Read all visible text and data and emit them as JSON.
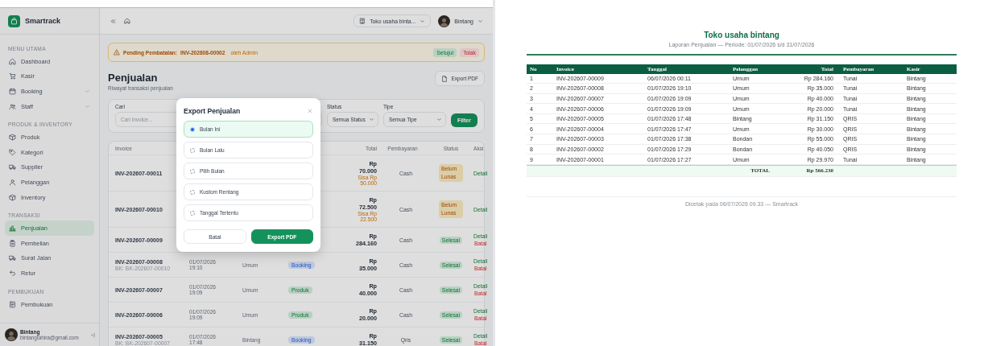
{
  "sidebar": {
    "brand": "Smartrack",
    "sections": [
      {
        "title": "MENU UTAMA",
        "items": [
          {
            "label": "Dashboard",
            "selected": false,
            "expandable": false
          },
          {
            "label": "Kasir",
            "selected": false,
            "expandable": false
          },
          {
            "label": "Booking",
            "selected": false,
            "expandable": true
          },
          {
            "label": "Staff",
            "selected": false,
            "expandable": true
          }
        ]
      },
      {
        "title": "PRODUK & INVENTORY",
        "items": [
          {
            "label": "Produk",
            "selected": false,
            "expandable": false
          },
          {
            "label": "Kategori",
            "selected": false,
            "expandable": false
          },
          {
            "label": "Supplier",
            "selected": false,
            "expandable": false
          },
          {
            "label": "Pelanggan",
            "selected": false,
            "expandable": false
          },
          {
            "label": "Inventory",
            "selected": false,
            "expandable": false
          }
        ]
      },
      {
        "title": "TRANSAKSI",
        "items": [
          {
            "label": "Penjualan",
            "selected": true,
            "expandable": false
          },
          {
            "label": "Pembelian",
            "selected": false,
            "expandable": false
          },
          {
            "label": "Surat Jalan",
            "selected": false,
            "expandable": false
          },
          {
            "label": "Retur",
            "selected": false,
            "expandable": false
          }
        ]
      },
      {
        "title": "PEMBUKUAN",
        "items": [
          {
            "label": "Pembukuan",
            "selected": false,
            "expandable": false
          }
        ]
      }
    ],
    "user": {
      "name": "Bintang",
      "email": "bintangtahira@gmail.com"
    }
  },
  "topbar": {
    "store": "Toko usaha binta...",
    "user": "Bintang"
  },
  "alert": {
    "label": "Pending Pembatalan:",
    "invoice": "INV-202608-00002",
    "by": "oleh Admin",
    "actions": [
      {
        "label": "Setujui",
        "kind": "approve"
      },
      {
        "label": "Tolak",
        "kind": "reject"
      }
    ]
  },
  "page": {
    "title": "Penjualan",
    "subtitle": "Riwayat transaksi penjualan",
    "export_button": "Export PDF"
  },
  "filters": {
    "fields": [
      {
        "label": "Cari",
        "kind": "text",
        "placeholder": "Cari invoice..."
      },
      {
        "label": "Status",
        "kind": "select",
        "value": "Semua Status"
      },
      {
        "label": "Tipe",
        "kind": "select",
        "value": "Semua Tipe"
      }
    ],
    "button": "Filter"
  },
  "table": {
    "columns": [
      "Invoice",
      "Total",
      "Pembayaran",
      "Status",
      "Aksi"
    ],
    "rows": [
      {
        "invoice": "INV-202607-00011",
        "total": "Rp 70.000",
        "remaining": "Sisa Rp 50.000",
        "payment": "Cash",
        "status": {
          "label": "Belum Lunas",
          "kind": "unpaid"
        },
        "actions": [
          {
            "label": "Detail",
            "kind": "detail"
          }
        ]
      },
      {
        "invoice": "INV-202607-00010",
        "total": "Rp 72.500",
        "remaining": "Sisa Rp 22.500",
        "payment": "Cash",
        "status": {
          "label": "Belum Lunas",
          "kind": "unpaid"
        },
        "actions": [
          {
            "label": "Detail",
            "kind": "detail"
          }
        ]
      },
      {
        "invoice": "INV-202607-00009",
        "total": "Rp 284.160",
        "payment": "Cash",
        "status": {
          "label": "Selesai",
          "kind": "done"
        },
        "actions": [
          {
            "label": "Detail",
            "kind": "detail"
          },
          {
            "label": "Batal",
            "kind": "cancel"
          }
        ]
      },
      {
        "invoice": "INV-202607-00008",
        "ref": "BK: BK-202607-00010",
        "date": "01/07/2026 19:10",
        "customer": "Umum",
        "type": {
          "label": "Booking",
          "kind": "booking"
        },
        "total": "Rp 35.000",
        "payment": "Cash",
        "status": {
          "label": "Selesai",
          "kind": "done"
        },
        "actions": [
          {
            "label": "Detail",
            "kind": "detail"
          },
          {
            "label": "Batal",
            "kind": "cancel"
          }
        ]
      },
      {
        "invoice": "INV-202607-00007",
        "date": "01/07/2026 19:09",
        "customer": "Umum",
        "type": {
          "label": "Produk",
          "kind": "product"
        },
        "total": "Rp 40.000",
        "payment": "Cash",
        "status": {
          "label": "Selesai",
          "kind": "done"
        },
        "actions": [
          {
            "label": "Detail",
            "kind": "detail"
          },
          {
            "label": "Batal",
            "kind": "cancel"
          }
        ]
      },
      {
        "invoice": "INV-202607-00006",
        "date": "01/07/2026 19:09",
        "customer": "Umum",
        "type": {
          "label": "Produk",
          "kind": "product"
        },
        "total": "Rp 20.000",
        "payment": "Cash",
        "status": {
          "label": "Selesai",
          "kind": "done"
        },
        "actions": [
          {
            "label": "Detail",
            "kind": "detail"
          },
          {
            "label": "Batal",
            "kind": "cancel"
          }
        ]
      },
      {
        "invoice": "INV-202607-00005",
        "ref": "BK: BK-202607-00007",
        "date": "01/07/2026 17:48",
        "customer": "Bintang",
        "type": {
          "label": "Booking",
          "kind": "booking"
        },
        "total": "Rp 31.150",
        "payment": "Qris",
        "status": {
          "label": "Selesai",
          "kind": "done"
        },
        "actions": [
          {
            "label": "Detail",
            "kind": "detail"
          },
          {
            "label": "Batal",
            "kind": "cancel"
          }
        ]
      }
    ]
  },
  "modal": {
    "title": "Export Penjualan",
    "options": [
      {
        "label": "Bulan Ini",
        "selected": true
      },
      {
        "label": "Bulan Lalu",
        "selected": false
      },
      {
        "label": "Pilih Bulan",
        "selected": false
      },
      {
        "label": "Kustom Rentang",
        "selected": false
      },
      {
        "label": "Tanggal Tertentu",
        "selected": false
      }
    ],
    "buttons": [
      {
        "label": "Batal",
        "kind": "secondary"
      },
      {
        "label": "Export PDF",
        "kind": "primary"
      }
    ]
  },
  "report": {
    "title": "Toko usaha bintang",
    "subtitle": "Laporan Penjualan — Periode: 01/07/2026 s/d 31/07/2026",
    "columns": [
      "No",
      "Invoice",
      "Tanggal",
      "Pelanggan",
      "Total",
      "Pembayaran",
      "Kasir"
    ],
    "rows": [
      [
        "1",
        "INV-202607-00009",
        "06/07/2026 00:11",
        "Umum",
        "Rp 284.160",
        "Tunai",
        "Bintang"
      ],
      [
        "2",
        "INV-202607-00008",
        "01/07/2026 19:10",
        "Umum",
        "Rp 35.000",
        "Tunai",
        "Bintang"
      ],
      [
        "3",
        "INV-202607-00007",
        "01/07/2026 19:09",
        "Umum",
        "Rp 40.000",
        "Tunai",
        "Bintang"
      ],
      [
        "4",
        "INV-202607-00006",
        "01/07/2026 19:09",
        "Umum",
        "Rp 20.000",
        "Tunai",
        "Bintang"
      ],
      [
        "5",
        "INV-202607-00005",
        "01/07/2026 17:48",
        "Bintang",
        "Rp 31.150",
        "QRIS",
        "Bintang"
      ],
      [
        "6",
        "INV-202607-00004",
        "01/07/2026 17:47",
        "Umum",
        "Rp 30.000",
        "QRIS",
        "Bintang"
      ],
      [
        "7",
        "INV-202607-00003",
        "01/07/2026 17:38",
        "Bondan",
        "Rp 55.000",
        "QRIS",
        "Bintang"
      ],
      [
        "8",
        "INV-202607-00002",
        "01/07/2026 17:29",
        "Bondan",
        "Rp 40.050",
        "QRIS",
        "Bintang"
      ],
      [
        "9",
        "INV-202607-00001",
        "01/07/2026 17:27",
        "Umum",
        "Rp 29.970",
        "Tunai",
        "Bintang"
      ]
    ],
    "total": {
      "label": "TOTAL",
      "value": "Rp 566.230"
    },
    "footer": "Dicetak pada 06/07/2026 09.33 — Smartrack"
  }
}
